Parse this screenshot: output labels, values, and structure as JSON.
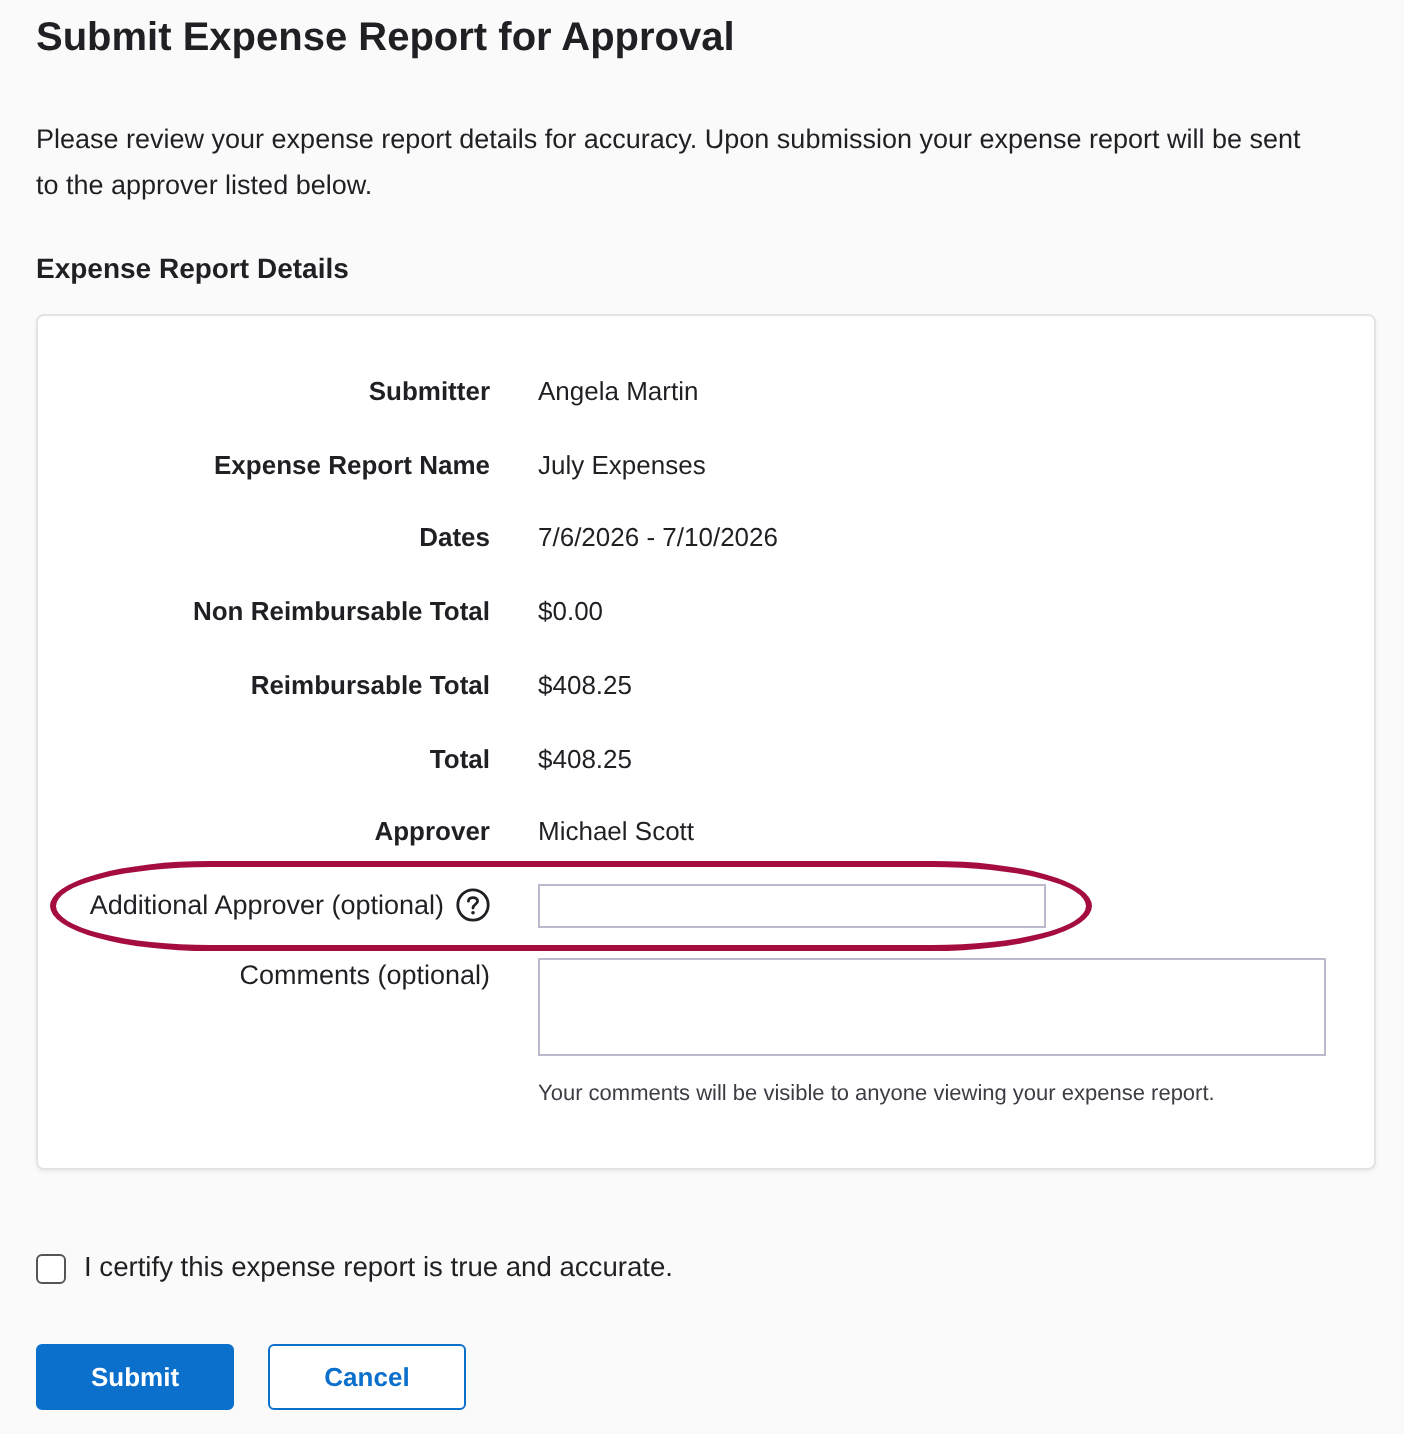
{
  "page": {
    "title": "Submit Expense Report for Approval",
    "intro": "Please review your expense report details for accuracy. Upon submission your expense report will be sent to the approver listed below."
  },
  "section": {
    "title": "Expense Report Details"
  },
  "details": [
    {
      "label": "Submitter",
      "value": "Angela Martin"
    },
    {
      "label": "Expense Report Name",
      "value": "July Expenses"
    },
    {
      "label": "Dates",
      "value": "7/6/2026 - 7/10/2026"
    },
    {
      "label": "Non Reimbursable Total",
      "value": "$0.00"
    },
    {
      "label": "Reimbursable Total",
      "value": "$408.25"
    },
    {
      "label": "Total",
      "value": "$408.25"
    },
    {
      "label": "Approver",
      "value": "Michael Scott"
    }
  ],
  "fields": [
    {
      "kind": "text",
      "label": "Additional Approver (optional)",
      "help_icon": true,
      "highlighted": true
    },
    {
      "kind": "textarea",
      "label": "Comments (optional)",
      "note": "Your comments will be visible to anyone viewing your expense report."
    }
  ],
  "certify": {
    "label": "I certify this expense report is true and accurate.",
    "checked": false
  },
  "buttons": [
    {
      "label": "Submit",
      "kind": "primary"
    },
    {
      "label": "Cancel",
      "kind": "secondary"
    }
  ]
}
